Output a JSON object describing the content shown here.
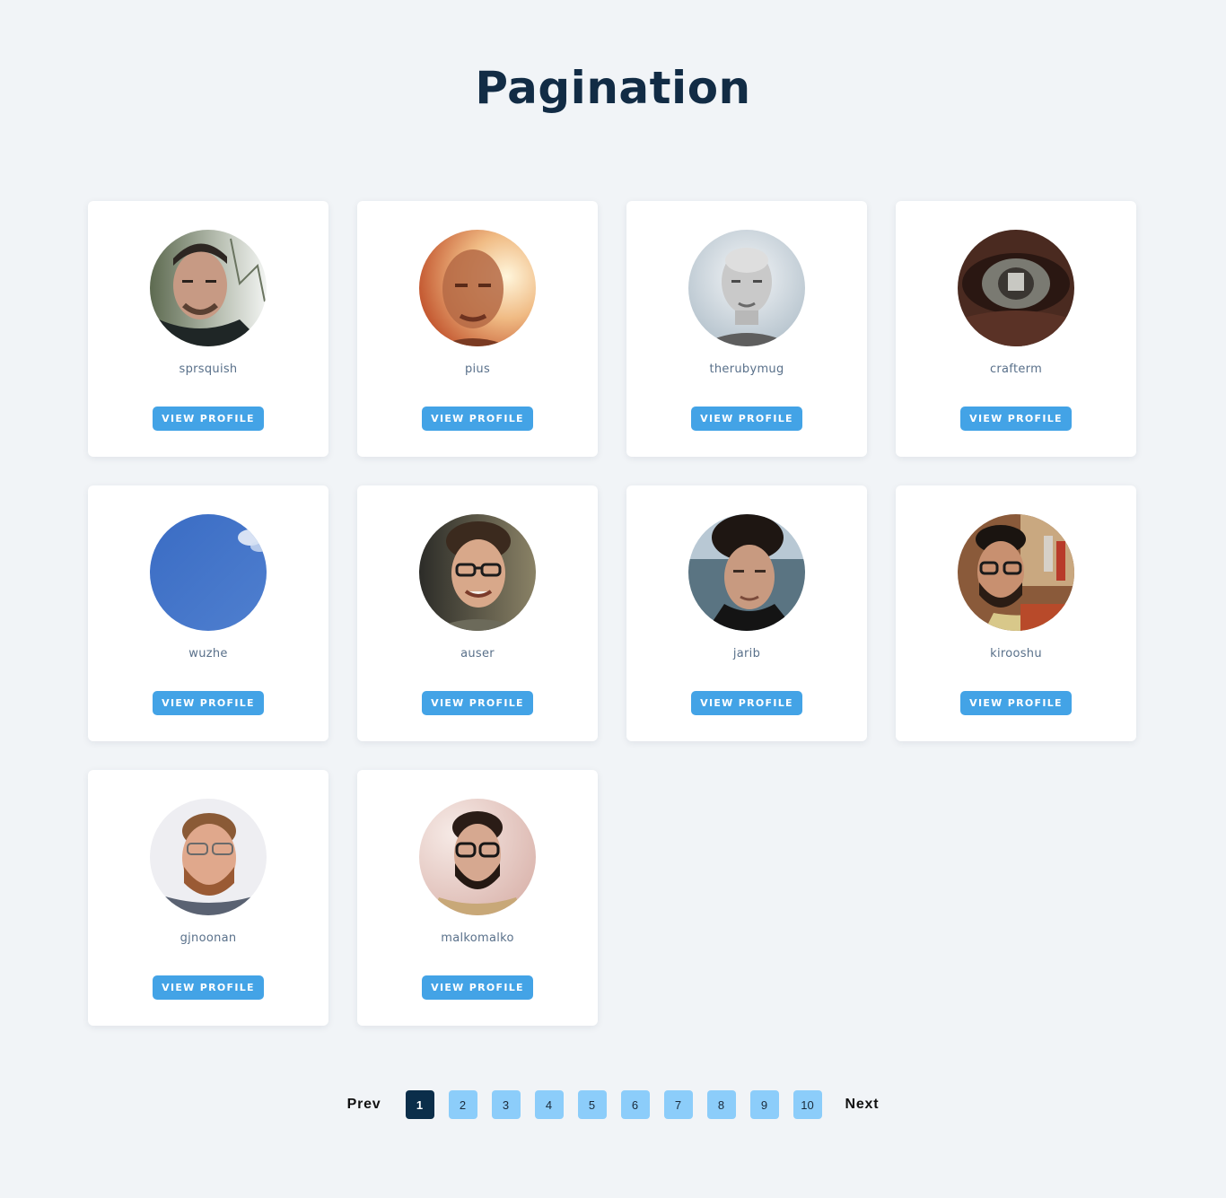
{
  "page": {
    "title": "Pagination"
  },
  "colors": {
    "background": "#f1f4f7",
    "title": "#122c45",
    "button": "#43a3e6",
    "page_active": "#0b2e4a",
    "page_inactive": "#8ccdfa"
  },
  "profiles": [
    {
      "username": "sprsquish",
      "button_label": "VIEW PROFILE",
      "avatar": "avatar-photo-man-outdoors"
    },
    {
      "username": "pius",
      "button_label": "VIEW PROFILE",
      "avatar": "avatar-photo-man-warm-light"
    },
    {
      "username": "therubymug",
      "button_label": "VIEW PROFILE",
      "avatar": "avatar-photo-man-bald-grayscale"
    },
    {
      "username": "crafterm",
      "button_label": "VIEW PROFILE",
      "avatar": "avatar-photo-eye-closeup"
    },
    {
      "username": "wuzhe",
      "button_label": "VIEW PROFILE",
      "avatar": "avatar-photo-blue-sky"
    },
    {
      "username": "auser",
      "button_label": "VIEW PROFILE",
      "avatar": "avatar-photo-man-glasses-curly"
    },
    {
      "username": "jarib",
      "button_label": "VIEW PROFILE",
      "avatar": "avatar-photo-man-dark-hair-sea"
    },
    {
      "username": "kirooshu",
      "button_label": "VIEW PROFILE",
      "avatar": "avatar-photo-man-beard-glasses-crowd"
    },
    {
      "username": "gjnoonan",
      "button_label": "VIEW PROFILE",
      "avatar": "avatar-photo-man-ginger-beard-glasses"
    },
    {
      "username": "malkomalko",
      "button_label": "VIEW PROFILE",
      "avatar": "avatar-photo-man-beard-glasses-pink"
    }
  ],
  "pagination": {
    "prev_label": "Prev",
    "next_label": "Next",
    "pages": [
      "1",
      "2",
      "3",
      "4",
      "5",
      "6",
      "7",
      "8",
      "9",
      "10"
    ],
    "current": "1"
  }
}
